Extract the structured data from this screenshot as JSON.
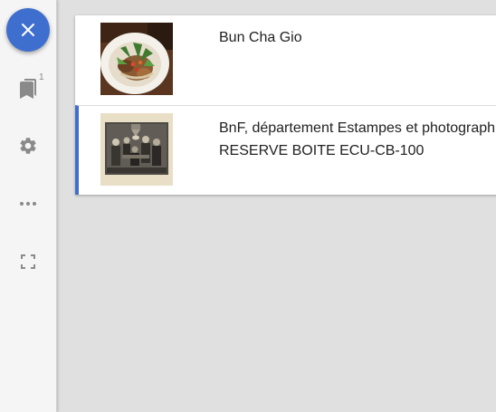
{
  "sidebar": {
    "close_label": "×",
    "bookmark_count": "1",
    "icons": [
      "close-icon",
      "bookmark-icon",
      "gear-icon",
      "more-icon",
      "fullscreen-icon"
    ],
    "accent_color": "#3f6fce"
  },
  "results": [
    {
      "lines": [
        "Bun Cha Gio"
      ],
      "selected": false
    },
    {
      "lines": [
        "BnF, département Estampes et photographie,",
        "RESERVE BOITE ECU-CB-100"
      ],
      "selected": true
    }
  ]
}
